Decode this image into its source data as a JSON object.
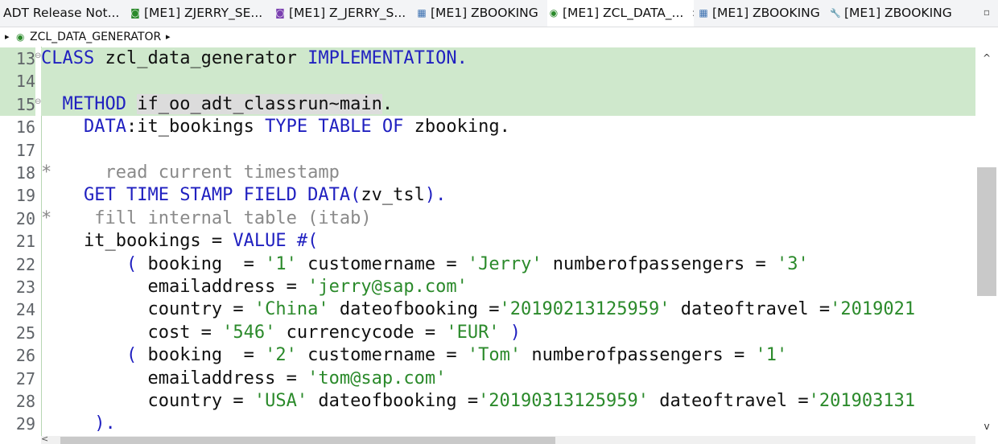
{
  "tabs": [
    {
      "icon": "",
      "label": "ADT Release Not..."
    },
    {
      "icon": "◙",
      "label": "[ME1] ZJERRY_SE..."
    },
    {
      "icon": "◙",
      "label": "[ME1] Z_JERRY_S..."
    },
    {
      "icon": "▦",
      "label": "[ME1] ZBOOKING"
    },
    {
      "icon": "◉",
      "label": "[ME1] ZCL_DATA_...",
      "close": "✕"
    },
    {
      "icon": "▦",
      "label": "[ME1] ZBOOKING"
    },
    {
      "icon": "🔧",
      "label": "[ME1] ZBOOKING"
    }
  ],
  "view_menu": "▫",
  "breadcrumb": {
    "arrow_left": "▸",
    "icon": "◉",
    "label": "ZCL_DATA_GENERATOR",
    "arrow_right": "▸"
  },
  "line_numbers": [
    "13",
    "14",
    "15",
    "16",
    "17",
    "18",
    "19",
    "20",
    "21",
    "22",
    "23",
    "24",
    "25",
    "26",
    "27",
    "28",
    "29"
  ],
  "fold_markers": {
    "13": "⊖",
    "15": "⊖"
  },
  "highlighted_lines": [
    "13",
    "14",
    "15"
  ],
  "comment_markers": {
    "18": "*",
    "20": "*"
  },
  "code": {
    "l13": {
      "kw1": "CLASS",
      "id": " zcl_data_generator ",
      "kw2": "IMPLEMENTATION",
      "dot": "."
    },
    "l15": {
      "indent": "  ",
      "kw": "METHOD",
      "sp": " ",
      "name": "if_oo_adt_classrun~main",
      "dot": "."
    },
    "l16": {
      "indent": "    ",
      "kw1": "DATA",
      "colon": ":",
      "var": "it_bookings ",
      "kw2": "TYPE TABLE OF",
      "type": " zbooking",
      "dot": "."
    },
    "l18": {
      "text": "     read current timestamp"
    },
    "l19": {
      "indent": "    ",
      "kw": "GET TIME STAMP FIELD DATA",
      "p1": "(",
      "var": "zv_tsl",
      "p2": ")",
      "dot": "."
    },
    "l20": {
      "text": "    fill internal table (itab)"
    },
    "l21": {
      "indent": "    ",
      "var": "it_bookings = ",
      "kw": "VALUE #",
      "p": "("
    },
    "l22": {
      "indent": "        ",
      "p": "(",
      "a1": " booking  = ",
      "s1": "'1'",
      "a2": " customername = ",
      "s2": "'Jerry'",
      "a3": " numberofpassengers = ",
      "s3": "'3'"
    },
    "l23": {
      "indent": "          ",
      "a1": "emailaddress = ",
      "s1": "'jerry@sap.com'"
    },
    "l24": {
      "indent": "          ",
      "a1": "country = ",
      "s1": "'China'",
      "a2": " dateofbooking =",
      "s2": "'20190213125959'",
      "a3": " dateoftravel =",
      "s3": "'2019021"
    },
    "l25": {
      "indent": "          ",
      "a1": "cost = ",
      "s1": "'546'",
      "a2": " currencycode = ",
      "s2": "'EUR'",
      "p": " )"
    },
    "l26": {
      "indent": "        ",
      "p": "(",
      "a1": " booking  = ",
      "s1": "'2'",
      "a2": " customername = ",
      "s2": "'Tom'",
      "a3": " numberofpassengers = ",
      "s3": "'1'"
    },
    "l27": {
      "indent": "          ",
      "a1": "emailaddress = ",
      "s1": "'tom@sap.com'"
    },
    "l28": {
      "indent": "          ",
      "a1": "country = ",
      "s1": "'USA'",
      "a2": " dateofbooking =",
      "s2": "'20190313125959'",
      "a3": " dateoftravel =",
      "s3": "'201903131"
    },
    "l29": {
      "indent": "     ",
      "p": ")",
      "dot": "."
    }
  },
  "scroll": {
    "up": "^",
    "down": "v",
    "left": "<"
  },
  "colors": {
    "highlight": "#cfe8cc",
    "keyword": "#2020c0",
    "string": "#2b8a2b",
    "comment": "#8a8a8a"
  }
}
